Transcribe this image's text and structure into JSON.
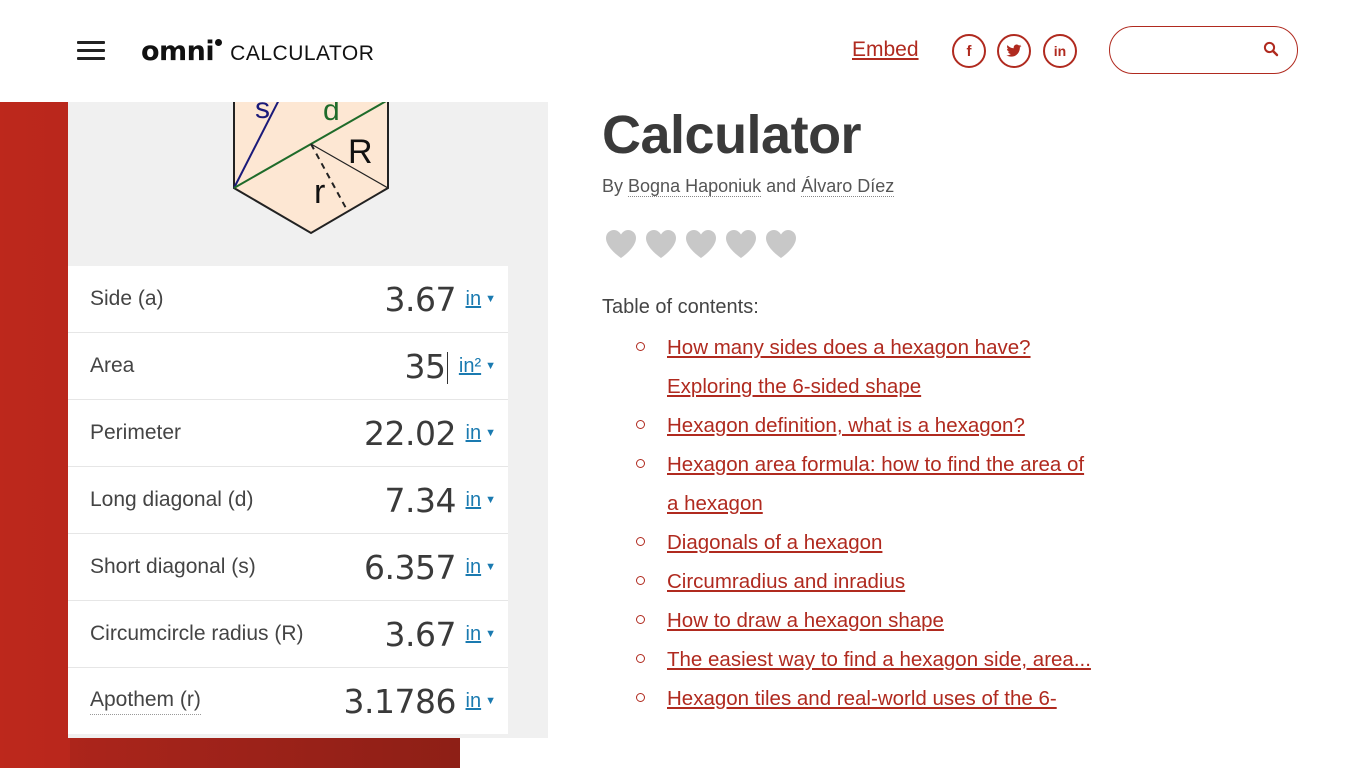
{
  "header": {
    "logo_word": "omni",
    "logo_suffix": "CALCULATOR",
    "embed_label": "Embed",
    "social": [
      {
        "icon": "facebook-icon",
        "glyph": "f"
      },
      {
        "icon": "twitter-icon",
        "glyph": "t"
      },
      {
        "icon": "linkedin-icon",
        "glyph": "in"
      }
    ],
    "search_placeholder": ""
  },
  "colors": {
    "brand_red": "#b02a1f",
    "unit_blue": "#1a7ab0",
    "heart_gray": "#c8c8c8"
  },
  "diagram": {
    "labels": {
      "s": "s",
      "d": "d",
      "R": "R",
      "r": "r"
    }
  },
  "calculator": {
    "rows": [
      {
        "label": "Side (a)",
        "value": "3.67",
        "unit": "in"
      },
      {
        "label": "Area",
        "value": "35",
        "unit": "in²"
      },
      {
        "label": "Perimeter",
        "value": "22.02",
        "unit": "in"
      },
      {
        "label": "Long diagonal (d)",
        "value": "7.34",
        "unit": "in"
      },
      {
        "label": "Short diagonal (s)",
        "value": "6.357",
        "unit": "in"
      },
      {
        "label": "Circumcircle radius (R)",
        "value": "3.67",
        "unit": "in"
      },
      {
        "label": "Apothem (r)",
        "value": "3.1786",
        "unit": "in"
      }
    ]
  },
  "main": {
    "title": "Calculator",
    "byline_prefix": "By",
    "author1": "Bogna Haponiuk",
    "byline_and": "and",
    "author2": "Álvaro Díez",
    "rating_hearts": 5,
    "toc_title": "Table of contents:",
    "toc": [
      "How many sides does a hexagon have? Exploring the 6-sided shape",
      "Hexagon definition, what is a hexagon?",
      "Hexagon area formula: how to find the area of a hexagon",
      "Diagonals of a hexagon",
      "Circumradius and inradius",
      "How to draw a hexagon shape",
      "The easiest way to find a hexagon side, area...",
      "Hexagon tiles and real-world uses of the 6-"
    ]
  }
}
